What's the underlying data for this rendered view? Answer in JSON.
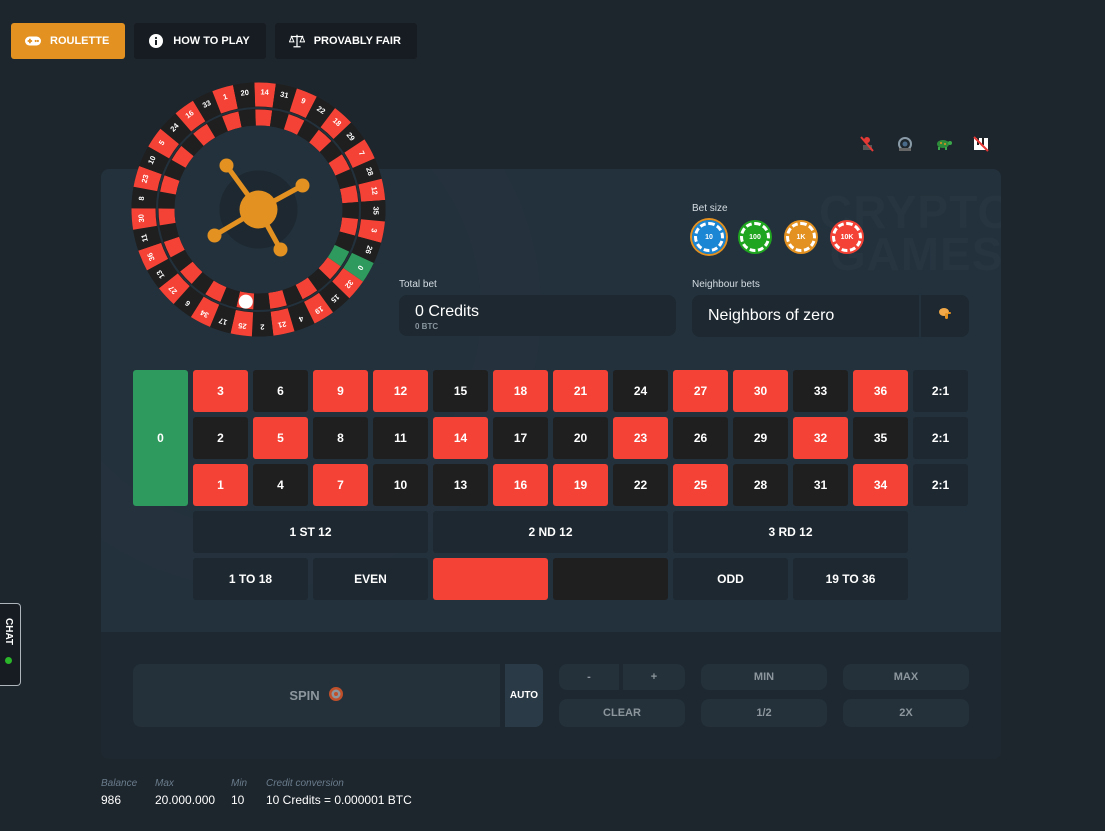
{
  "nav": {
    "tabs": [
      {
        "label": "ROULETTE",
        "icon": "gamepad-icon",
        "active": true
      },
      {
        "label": "HOW TO PLAY",
        "icon": "info-icon",
        "active": false
      },
      {
        "label": "PROVABLY FAIR",
        "icon": "scales-icon",
        "active": false
      }
    ]
  },
  "sound_icons": [
    "sound-off-icon",
    "speed-icon",
    "turtle-icon",
    "music-off-icon"
  ],
  "watermark": {
    "line1": "CRYPTO",
    "line2": "GAMES"
  },
  "wheel": {
    "numbers_clockwise_from_top": [
      14,
      31,
      9,
      22,
      18,
      29,
      7,
      28,
      12,
      35,
      3,
      26,
      0,
      32,
      15,
      19,
      4,
      21,
      2,
      25,
      17,
      34,
      6,
      27,
      13,
      36,
      11,
      30,
      8,
      23,
      10,
      5,
      24,
      16,
      33,
      1,
      20
    ],
    "red_numbers": [
      1,
      3,
      5,
      7,
      9,
      12,
      14,
      16,
      18,
      19,
      21,
      23,
      25,
      27,
      30,
      32,
      34,
      36
    ],
    "ball_on": 25
  },
  "total_bet": {
    "label": "Total bet",
    "value": "0 Credits",
    "sub": "0 BTC"
  },
  "bet_size": {
    "label": "Bet size",
    "chips": [
      {
        "label": "10",
        "color": "#1b86d4",
        "selected": true
      },
      {
        "label": "100",
        "color": "#1fa51f",
        "selected": false
      },
      {
        "label": "1K",
        "color": "#e39120",
        "selected": false
      },
      {
        "label": "10K",
        "color": "#f44336",
        "selected": false
      }
    ]
  },
  "neighbour_bets": {
    "label": "Neighbour bets",
    "value": "Neighbors of zero",
    "icon": "hand-pointer-icon"
  },
  "table": {
    "zero": "0",
    "rows": [
      [
        3,
        6,
        9,
        12,
        15,
        18,
        21,
        24,
        27,
        30,
        33,
        36
      ],
      [
        2,
        5,
        8,
        11,
        14,
        17,
        20,
        23,
        26,
        29,
        32,
        35
      ],
      [
        1,
        4,
        7,
        10,
        13,
        16,
        19,
        22,
        25,
        28,
        31,
        34
      ]
    ],
    "column_bets": [
      "2:1",
      "2:1",
      "2:1"
    ],
    "dozens": [
      "1 ST 12",
      "2 ND 12",
      "3 RD 12"
    ],
    "outside": [
      "1 TO 18",
      "EVEN",
      "",
      "",
      "ODD",
      "19 TO 36"
    ]
  },
  "controls": {
    "spin": "SPIN",
    "auto": "AUTO",
    "minus": "-",
    "plus": "+",
    "min": "MIN",
    "max": "MAX",
    "clear": "CLEAR",
    "half": "1/2",
    "double": "2X"
  },
  "stats": [
    {
      "label": "Balance",
      "value": "986"
    },
    {
      "label": "Max",
      "value": "20.000.000"
    },
    {
      "label": "Min",
      "value": "10"
    },
    {
      "label": "Credit conversion",
      "value": "10 Credits = 0.000001 BTC"
    }
  ],
  "chat": {
    "label": "CHAT",
    "status_color": "#2ab52a"
  },
  "colors": {
    "accent": "#e39120",
    "red": "#f44336",
    "black": "#1f1f1f",
    "green": "#2e9a5d"
  }
}
